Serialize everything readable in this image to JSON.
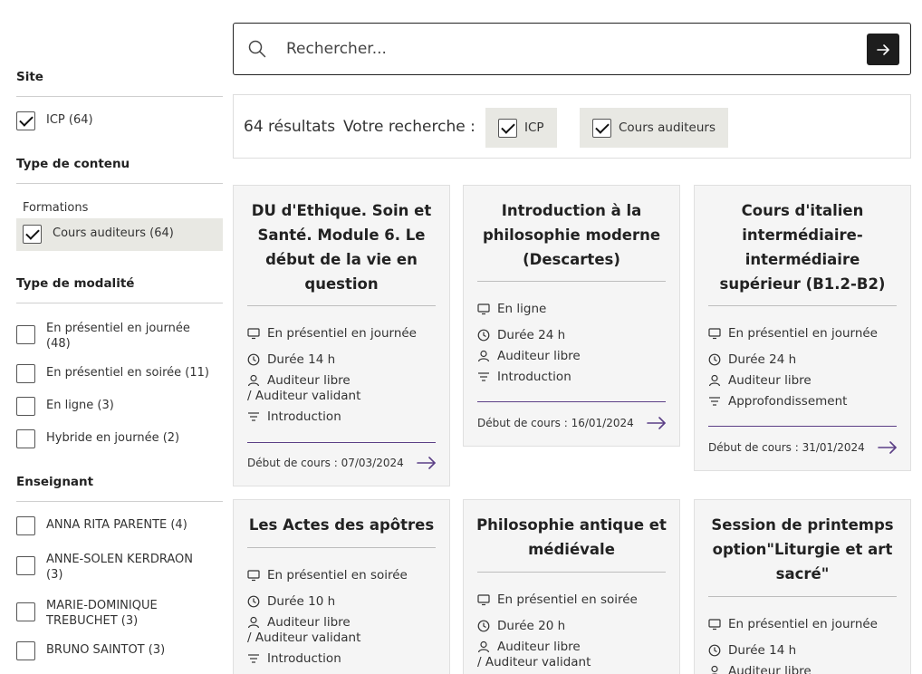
{
  "sidebar": {
    "site_title": "Site",
    "site_items": [
      {
        "label": "ICP (64)",
        "checked": true
      }
    ],
    "type_contenu_title": "Type de contenu",
    "formations_label": "Formations",
    "type_contenu_items": [
      {
        "label": "Cours auditeurs (64)",
        "checked": true
      }
    ],
    "modalite_title": "Type de modalité",
    "modalite_items": [
      {
        "label": "En présentiel en journée (48)",
        "checked": false
      },
      {
        "label": "En présentiel en soirée (11)",
        "checked": false
      },
      {
        "label": "En ligne (3)",
        "checked": false
      },
      {
        "label": "Hybride en journée (2)",
        "checked": false
      }
    ],
    "enseignant_title": "Enseignant",
    "enseignant_items": [
      {
        "label": "ANNA RITA PARENTE (4)",
        "checked": false
      },
      {
        "label": "ANNE-SOLEN KERDRAON (3)",
        "checked": false
      },
      {
        "label": "MARIE-DOMINIQUE TREBUCHET (3)",
        "checked": false
      },
      {
        "label": "BRUNO SAINTOT (3)",
        "checked": false
      }
    ]
  },
  "search": {
    "placeholder": "Rechercher..."
  },
  "results": {
    "count": "64 résultats",
    "label": "Votre recherche :",
    "chips": [
      {
        "label": "ICP"
      },
      {
        "label": "Cours auditeurs"
      }
    ]
  },
  "cards": [
    {
      "title": "DU d'Ethique. Soin et Santé. Module 6. Le début de la vie en question",
      "modalite": "En présentiel en journée",
      "duree": "Durée 14 h",
      "public": "Auditeur libre",
      "public_extra": "/  Auditeur validant",
      "niveau": "Introduction",
      "date": "Début de cours : 07/03/2024"
    },
    {
      "title": "Introduction à la philosophie moderne (Descartes)",
      "modalite": "En ligne",
      "duree": "Durée 24 h",
      "public": "Auditeur libre",
      "public_extra": "",
      "niveau": "Introduction",
      "date": "Début de cours : 16/01/2024"
    },
    {
      "title": "Cours d'italien intermédiaire-intermédiaire supérieur (B1.2-B2)",
      "modalite": "En présentiel en journée",
      "duree": "Durée 24 h",
      "public": "Auditeur libre",
      "public_extra": "",
      "niveau": "Approfondissement",
      "date": "Début de cours : 31/01/2024"
    },
    {
      "title": "Les Actes des apôtres",
      "modalite": "En présentiel en soirée",
      "duree": "Durée 10 h",
      "public": "Auditeur libre",
      "public_extra": "/  Auditeur validant",
      "niveau": "Introduction",
      "date": ""
    },
    {
      "title": "Philosophie antique et médiévale",
      "modalite": "En présentiel en soirée",
      "duree": "Durée 20 h",
      "public": "Auditeur libre",
      "public_extra": "/  Auditeur validant",
      "niveau": "",
      "date": ""
    },
    {
      "title": "Session de printemps option\"Liturgie et art sacré\"",
      "modalite": "En présentiel en journée",
      "duree": "Durée 14 h",
      "public": "Auditeur libre",
      "public_extra": "",
      "niveau": "",
      "date": ""
    }
  ],
  "colors": {
    "accent": "#5b3f86",
    "chip_bg": "#e8e8e3",
    "card_bg": "#f5f5f5"
  }
}
